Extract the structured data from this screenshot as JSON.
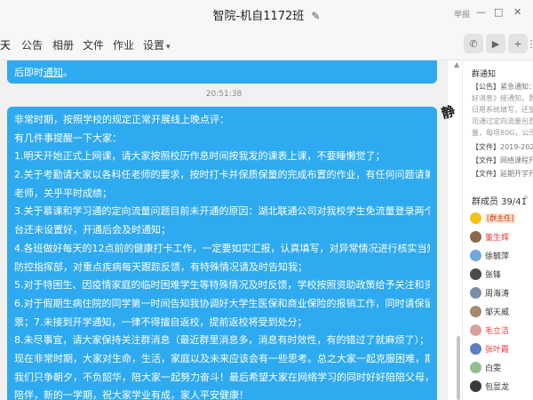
{
  "window": {
    "title": "智院-机自1172班",
    "report_label": "举报",
    "controls": [
      "—",
      "□",
      "✕"
    ]
  },
  "tabs": [
    {
      "label": "天"
    },
    {
      "label": "公告"
    },
    {
      "label": "相册"
    },
    {
      "label": "文件"
    },
    {
      "label": "作业"
    },
    {
      "label": "设置"
    }
  ],
  "chat": {
    "prev_message": {
      "text": "后即时",
      "link": "通知",
      "tail": "。"
    },
    "timestamp": "20:51:38",
    "message_lines": [
      "非常时期，按照学校的规定正常开展线上晚点评：",
      "有几件事提醒一下大家：",
      "1.明天开始正式上网课，请大家按照校历作息时间按我发的课表上课，不要睡懒觉了；",
      "2.关于考勤请大家以各科任老师的要求，按时打卡并保质保量的完成布置的作业，有任何问题请第一时间联系科任",
      "老师，关乎平时成绩；",
      "3.关于慕课和学习通的定向流量问题目前未开通的原因：湖北联通公司对我校学生免流量登录两个学习平台目前后",
      "台还未设置好，开通后会及时通知；",
      "4.各班做好每天的12点前的健康打卡工作，一定要如实汇报，认真填写，对异常情况进行核实当知系统将及时上报",
      "防控指挥部，对重点疾病每天跟踪反馈，有特殊情况请及时告知我；",
      "5.对于特困生、因疫情家庭的临时困难学生等特殊情况及时反馈，学校按照资助政策给予关注和资助；",
      "6.对于假期生病住院的同学第一时间告知我协调好大学生医保和商业保险的报销工作，同时请保留好住院资料和发",
      "票；7.未接到开学通知，一律不得擅自返校，提前返校将受到处分；",
      "8.未尽事宜，请大家保持关注群消息（最近群里消息多，消息有时效性，有的错过了就麻烦了）；",
      "现在非常时期，大家对生命，生活，家庭以及未来应该会有一些思考。总之大家一起克服困难，期待着疫情之后，",
      "我们只争朝夕，不负韶华，陪大家一起努力奋斗！最后希望大家在网络学习的同时好好陪陪父母，来之不易的亲情",
      "陪伴，新的一学期，祝大家学业有成，家人平安健康！"
    ]
  },
  "sidebar": {
    "notice_title": "群通知",
    "notices": [
      {
        "tag": "【公告】",
        "text": "紧急通知：一..."
      },
      {
        "tag": "",
        "text": "好消息》接通知，我..."
      },
      {
        "tag": "",
        "text": "日用系统填写，还望..."
      },
      {
        "tag": "",
        "text": "司通过定向流量包登陆"
      },
      {
        "tag": "",
        "text": "量，每项80G，公司..."
      },
      {
        "tag": "【文件】",
        "text": "2019-2020-2..."
      },
      {
        "tag": "【文件】",
        "text": "网络课程开课表..."
      },
      {
        "tag": "【文件】",
        "text": "延期开学开课..."
      }
    ],
    "members_header": "群成员 39/41",
    "members": [
      {
        "name": "[群主任]",
        "type": "owner",
        "color": "#f3c21b"
      },
      {
        "name": "董生辉",
        "type": "red",
        "color": "#8a6a4a"
      },
      {
        "name": "徐毓萍",
        "type": "normal",
        "color": "#6fa8dc"
      },
      {
        "name": "张锋",
        "type": "normal",
        "color": "#4a4a4a"
      },
      {
        "name": "周海涛",
        "type": "normal",
        "color": "#7a8fa6"
      },
      {
        "name": "邹天威",
        "type": "normal",
        "color": "#a48b6e"
      },
      {
        "name": "毛立洁",
        "type": "red",
        "color": "#d9a0a0"
      },
      {
        "name": "张叶霞",
        "type": "red",
        "color": "#5c7fbf"
      },
      {
        "name": "白雯",
        "type": "normal",
        "color": "#8fbf8f"
      },
      {
        "name": "包显龙",
        "type": "normal",
        "color": "#3a3a3a"
      }
    ]
  },
  "icons": {
    "edit": "pencil-icon",
    "phone": "phone-icon",
    "video": "video-icon",
    "add": "add-app-icon",
    "more": "more-icon",
    "search": "search-icon"
  }
}
